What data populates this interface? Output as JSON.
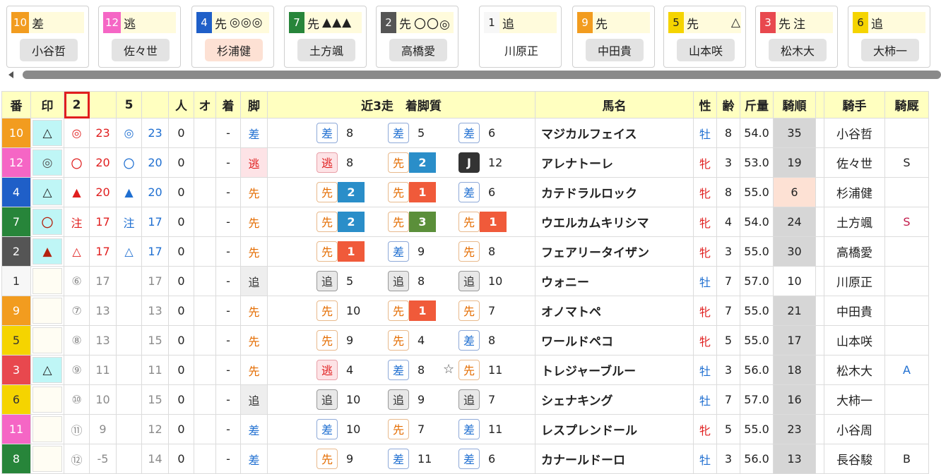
{
  "colors": {
    "waku": {
      "1": "#f7f7f7",
      "2": "#555555",
      "3": "#e8484e",
      "4": "#1f5fc8",
      "5": "#f5d400",
      "6": "#f5d400",
      "7": "#27853a",
      "8": "#27853a",
      "9": "#f29c1f",
      "10": "#f29c1f",
      "11": "#f566c5",
      "12": "#f566c5"
    },
    "badge": {
      "1": "#f05a3a",
      "2": "#2a8ec9",
      "3": "#5b8f3a"
    },
    "mark_bg": "#bff6f6",
    "header_bg": "#ffffc0"
  },
  "cards": [
    {
      "num": "10",
      "style": "差",
      "marks": "",
      "jockey": "小谷哲",
      "jk_style": "normal"
    },
    {
      "num": "12",
      "style": "逃",
      "marks": "",
      "jockey": "佐々世",
      "jk_style": "normal"
    },
    {
      "num": "4",
      "style": "先",
      "marks": "◎◎◎",
      "jockey": "杉浦健",
      "jk_style": "hl"
    },
    {
      "num": "7",
      "style": "先",
      "marks": "▲▲▲",
      "jockey": "土方颯",
      "jk_style": "normal"
    },
    {
      "num": "2",
      "style": "先",
      "marks": "〇〇◎",
      "jockey": "高橋愛",
      "jk_style": "normal"
    },
    {
      "num": "1",
      "style": "追",
      "marks": "",
      "jockey": "川原正",
      "jk_style": "plain"
    },
    {
      "num": "9",
      "style": "先",
      "marks": "",
      "jockey": "中田貴",
      "jk_style": "normal"
    },
    {
      "num": "5",
      "style": "先",
      "marks": "△",
      "jockey": "山本咲",
      "jk_style": "normal"
    },
    {
      "num": "3",
      "style": "先",
      "marks": "注",
      "jockey": "松木大",
      "jk_style": "normal"
    },
    {
      "num": "6",
      "style": "追",
      "marks": "",
      "jockey": "大柿一",
      "jk_style": "normal"
    }
  ],
  "headers": {
    "ban": "番",
    "shirushi": "印",
    "c2": "2",
    "c5": "5",
    "ninki": "人",
    "odds": "オ",
    "chaku": "着",
    "kyaku": "脚",
    "recent": "近3走　着脚質",
    "horse": "馬名",
    "sex": "性",
    "age": "齢",
    "weight": "斤量",
    "kijun": "騎順",
    "jockey": "騎手",
    "kiyu": "騎厩"
  },
  "rows": [
    {
      "ban": "10",
      "mark": "△",
      "m2": "◎",
      "s2": "23",
      "m5": "◎",
      "s5": "23",
      "ninki": "0",
      "odds": "",
      "chaku": "-",
      "leg": "差",
      "runs": [
        {
          "l": "差",
          "p": "8"
        },
        {
          "l": "差",
          "p": "5"
        },
        {
          "l": "差",
          "p": "6"
        }
      ],
      "horse": "マジカルフェイス",
      "sex": "牡",
      "age": "8",
      "weight": "54.0",
      "kijun": "35",
      "jockey": "小谷哲",
      "kiyu": ""
    },
    {
      "ban": "12",
      "mark": "◎",
      "m2": "〇",
      "s2": "20",
      "m5": "〇",
      "s5": "20",
      "ninki": "0",
      "odds": "",
      "chaku": "-",
      "leg": "逃",
      "runs": [
        {
          "l": "逃",
          "p": "8"
        },
        {
          "l": "先",
          "p": "2",
          "b": "2"
        },
        {
          "l": "J",
          "p": "12"
        }
      ],
      "horse": "アレナトーレ",
      "sex": "牝",
      "age": "3",
      "weight": "53.0",
      "kijun": "19",
      "jockey": "佐々世",
      "kiyu": "S"
    },
    {
      "ban": "4",
      "mark": "△",
      "m2": "▲",
      "s2": "20",
      "m5": "▲",
      "s5": "20",
      "ninki": "0",
      "odds": "",
      "chaku": "-",
      "leg": "先",
      "runs": [
        {
          "l": "先",
          "p": "2",
          "b": "2"
        },
        {
          "l": "先",
          "p": "1",
          "b": "1"
        },
        {
          "l": "差",
          "p": "6"
        }
      ],
      "horse": "カテドラルロック",
      "sex": "牝",
      "age": "8",
      "weight": "55.0",
      "kijun": "6",
      "jockey": "杉浦健",
      "kiyu": ""
    },
    {
      "ban": "7",
      "mark": "〇",
      "m2": "注",
      "s2": "17",
      "m5": "注",
      "s5": "17",
      "ninki": "0",
      "odds": "",
      "chaku": "-",
      "leg": "先",
      "runs": [
        {
          "l": "先",
          "p": "2",
          "b": "2"
        },
        {
          "l": "先",
          "p": "3",
          "b": "3"
        },
        {
          "l": "先",
          "p": "1",
          "b": "1"
        }
      ],
      "horse": "ウエルカムキリシマ",
      "sex": "牝",
      "age": "4",
      "weight": "54.0",
      "kijun": "24",
      "jockey": "土方颯",
      "kiyu": "S"
    },
    {
      "ban": "2",
      "mark": "▲",
      "m2": "△",
      "s2": "17",
      "m5": "△",
      "s5": "17",
      "ninki": "0",
      "odds": "",
      "chaku": "-",
      "leg": "先",
      "runs": [
        {
          "l": "先",
          "p": "1",
          "b": "1"
        },
        {
          "l": "差",
          "p": "9"
        },
        {
          "l": "先",
          "p": "8"
        }
      ],
      "horse": "フェアリータイザン",
      "sex": "牝",
      "age": "3",
      "weight": "55.0",
      "kijun": "30",
      "jockey": "高橋愛",
      "kiyu": ""
    },
    {
      "ban": "1",
      "mark": "",
      "m2": "⑥",
      "s2": "17",
      "m5": "",
      "s5": "17",
      "ninki": "0",
      "odds": "",
      "chaku": "-",
      "leg": "追",
      "runs": [
        {
          "l": "追",
          "p": "5"
        },
        {
          "l": "追",
          "p": "8"
        },
        {
          "l": "追",
          "p": "10"
        }
      ],
      "horse": "ウォニー",
      "sex": "牡",
      "age": "7",
      "weight": "57.0",
      "kijun": "10",
      "jockey": "川原正",
      "kiyu": ""
    },
    {
      "ban": "9",
      "mark": "",
      "m2": "⑦",
      "s2": "13",
      "m5": "",
      "s5": "13",
      "ninki": "0",
      "odds": "",
      "chaku": "-",
      "leg": "先",
      "runs": [
        {
          "l": "先",
          "p": "10"
        },
        {
          "l": "先",
          "p": "1",
          "b": "1"
        },
        {
          "l": "先",
          "p": "7"
        }
      ],
      "horse": "オノマトペ",
      "sex": "牝",
      "age": "7",
      "weight": "55.0",
      "kijun": "21",
      "jockey": "中田貴",
      "kiyu": ""
    },
    {
      "ban": "5",
      "mark": "",
      "m2": "⑧",
      "s2": "13",
      "m5": "",
      "s5": "15",
      "ninki": "0",
      "odds": "",
      "chaku": "-",
      "leg": "先",
      "runs": [
        {
          "l": "先",
          "p": "9"
        },
        {
          "l": "先",
          "p": "4"
        },
        {
          "l": "差",
          "p": "8"
        }
      ],
      "horse": "ワールドペコ",
      "sex": "牝",
      "age": "5",
      "weight": "55.0",
      "kijun": "17",
      "jockey": "山本咲",
      "kiyu": ""
    },
    {
      "ban": "3",
      "mark": "△",
      "m2": "⑨",
      "s2": "11",
      "m5": "",
      "s5": "11",
      "ninki": "0",
      "odds": "",
      "chaku": "-",
      "leg": "先",
      "runs": [
        {
          "l": "逃",
          "p": "4"
        },
        {
          "l": "差",
          "p": "8"
        },
        {
          "l": "先",
          "p": "11",
          "star": "☆"
        }
      ],
      "horse": "トレジャーブルー",
      "sex": "牡",
      "age": "3",
      "weight": "56.0",
      "kijun": "18",
      "jockey": "松木大",
      "kiyu": "A"
    },
    {
      "ban": "6",
      "mark": "",
      "m2": "⑩",
      "s2": "10",
      "m5": "",
      "s5": "15",
      "ninki": "0",
      "odds": "",
      "chaku": "-",
      "leg": "追",
      "runs": [
        {
          "l": "追",
          "p": "10"
        },
        {
          "l": "追",
          "p": "9"
        },
        {
          "l": "追",
          "p": "7"
        }
      ],
      "horse": "シェナキング",
      "sex": "牡",
      "age": "7",
      "weight": "57.0",
      "kijun": "16",
      "jockey": "大柿一",
      "kiyu": ""
    },
    {
      "ban": "11",
      "mark": "",
      "m2": "⑪",
      "s2": "9",
      "m5": "",
      "s5": "12",
      "ninki": "0",
      "odds": "",
      "chaku": "-",
      "leg": "差",
      "runs": [
        {
          "l": "差",
          "p": "10"
        },
        {
          "l": "先",
          "p": "7"
        },
        {
          "l": "差",
          "p": "11"
        }
      ],
      "horse": "レスプレンドール",
      "sex": "牝",
      "age": "5",
      "weight": "55.0",
      "kijun": "23",
      "jockey": "小谷周",
      "kiyu": ""
    },
    {
      "ban": "8",
      "mark": "",
      "m2": "⑫",
      "s2": "-5",
      "m5": "",
      "s5": "14",
      "ninki": "0",
      "odds": "",
      "chaku": "-",
      "leg": "差",
      "runs": [
        {
          "l": "先",
          "p": "9"
        },
        {
          "l": "差",
          "p": "11"
        },
        {
          "l": "差",
          "p": "6"
        }
      ],
      "horse": "カナールドーロ",
      "sex": "牡",
      "age": "3",
      "weight": "56.0",
      "kijun": "13",
      "jockey": "長谷駿",
      "kiyu": "B"
    }
  ]
}
